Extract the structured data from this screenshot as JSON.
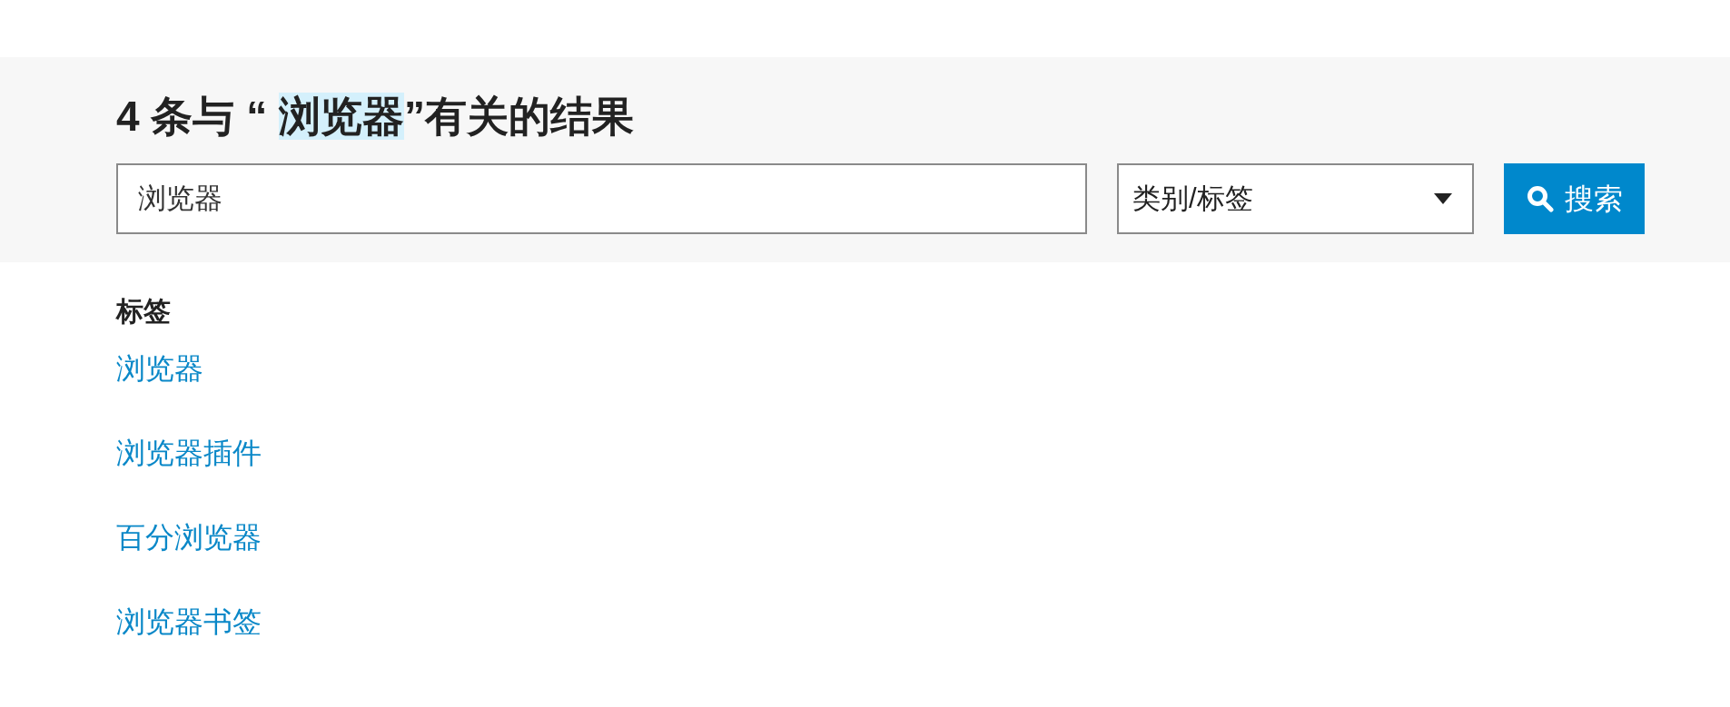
{
  "results_title": {
    "prefix": "4 条与 “ ",
    "query": "浏览器",
    "suffix": "”有关的结果"
  },
  "search": {
    "value": "浏览器",
    "category": "类别/标签",
    "button": "搜索"
  },
  "tags": {
    "heading": "标签",
    "items": [
      "浏览器",
      "浏览器插件",
      "百分浏览器",
      "浏览器书签"
    ]
  }
}
